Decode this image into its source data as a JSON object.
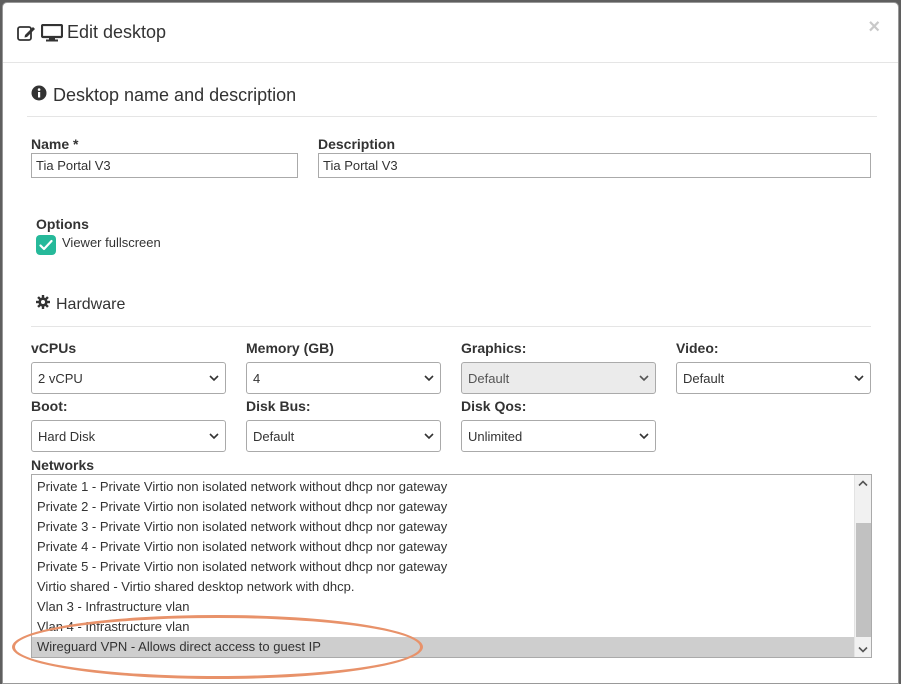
{
  "dialog": {
    "title": "Edit desktop",
    "close_label": "×"
  },
  "section_name": {
    "title": "Desktop name and description",
    "name_label": "Name *",
    "name_value": "Tia Portal V3",
    "description_label": "Description",
    "description_value": "Tia Portal V3"
  },
  "options": {
    "label": "Options",
    "viewer_fullscreen_label": "Viewer fullscreen",
    "viewer_fullscreen_checked": true
  },
  "hardware": {
    "title": "Hardware",
    "vcpus_label": "vCPUs",
    "vcpus_value": "2 vCPU",
    "memory_label": "Memory (GB)",
    "memory_value": "4",
    "graphics_label": "Graphics:",
    "graphics_value": "Default",
    "video_label": "Video:",
    "video_value": "Default",
    "boot_label": "Boot:",
    "boot_value": "Hard Disk",
    "diskbus_label": "Disk Bus:",
    "diskbus_value": "Default",
    "diskqos_label": "Disk Qos:",
    "diskqos_value": "Unlimited"
  },
  "networks": {
    "label": "Networks",
    "options": [
      "Private 1 - Private Virtio non isolated network without dhcp nor gateway",
      "Private 2 - Private Virtio non isolated network without dhcp nor gateway",
      "Private 3 - Private Virtio non isolated network without dhcp nor gateway",
      "Private 4 - Private Virtio non isolated network without dhcp nor gateway",
      "Private 5 - Private Virtio non isolated network without dhcp nor gateway",
      "Virtio shared - Virtio shared desktop network with dhcp.",
      "Vlan 3 - Infrastructure vlan",
      "Vlan 4 - Infrastructure vlan",
      "Wireguard VPN - Allows direct access to guest IP"
    ],
    "selected": "Wireguard VPN - Allows direct access to guest IP"
  },
  "colors": {
    "accent_green": "#26b99a",
    "highlight_orange": "#e8926a"
  }
}
